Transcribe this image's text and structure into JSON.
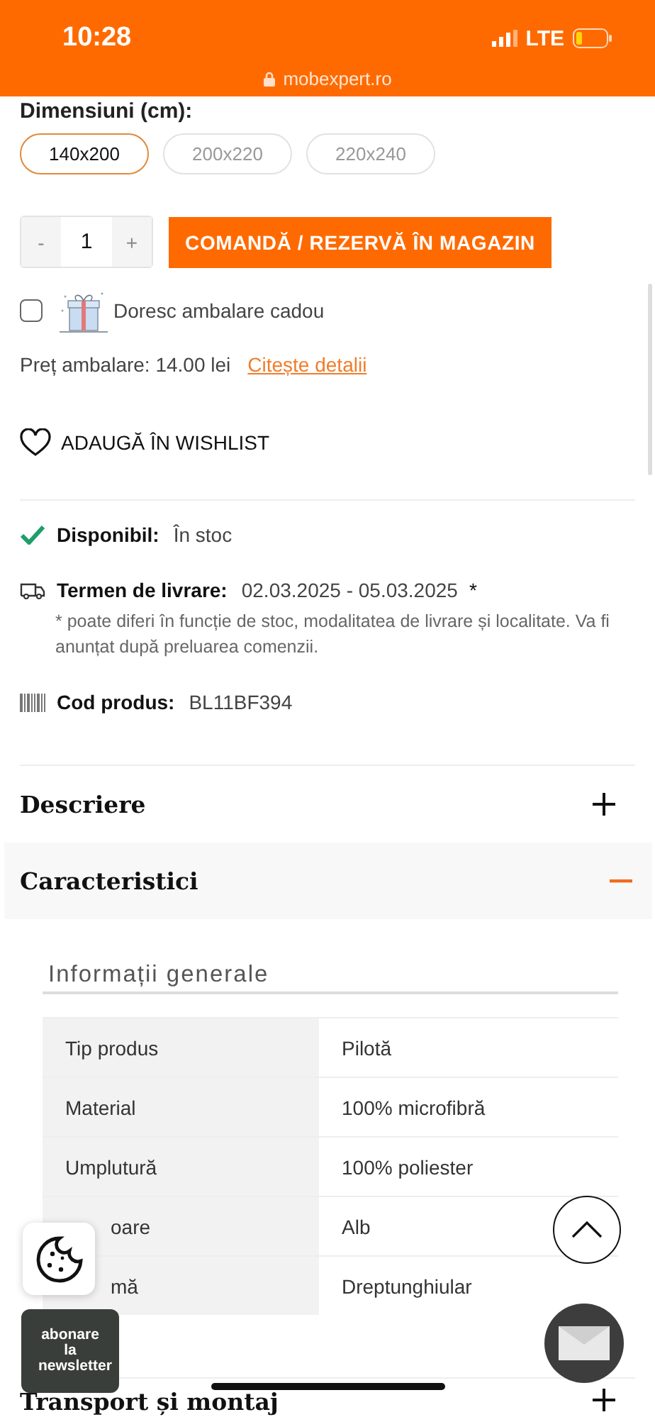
{
  "status_bar": {
    "time": "10:28",
    "network": "LTE",
    "url": "mobexpert.ro"
  },
  "dimensions": {
    "label": "Dimensiuni (cm):",
    "options": [
      {
        "label": "140x200",
        "selected": true
      },
      {
        "label": "200x220",
        "selected": false
      },
      {
        "label": "220x240",
        "selected": false
      }
    ]
  },
  "quantity": {
    "minus": "-",
    "value": "1",
    "plus": "+"
  },
  "order_button": "COMANDĂ / REZERVĂ ÎN MAGAZIN",
  "gift": {
    "label": "Doresc ambalare cadou",
    "checked": false
  },
  "gift_price": {
    "text": "Preț ambalare: 14.00 lei",
    "link": "Citește detalii"
  },
  "wishlist": "ADAUGĂ ÎN WISHLIST",
  "availability": {
    "label": "Disponibil:",
    "value": "În stoc"
  },
  "delivery": {
    "label": "Termen de livrare:",
    "value": "02.03.2025 - 05.03.2025",
    "mark": "*",
    "note": "* poate diferi în funcție de stoc, modalitatea de livrare și localitate. Va fi anunțat după preluarea comenzii."
  },
  "code": {
    "label": "Cod produs:",
    "value": "BL11BF394"
  },
  "sections": [
    {
      "title": "Descriere",
      "expanded": false
    },
    {
      "title": "Caracteristici",
      "expanded": true
    }
  ],
  "specs": {
    "title": "Informații generale",
    "rows": [
      {
        "name": "Tip produs",
        "value": "Pilotă",
        "covered": false
      },
      {
        "name": "Material",
        "value": "100% microfibră",
        "covered": false
      },
      {
        "name": "Umplutură",
        "value": "100% poliester",
        "covered": false
      },
      {
        "name": "oare",
        "value": "Alb",
        "covered": true
      },
      {
        "name": "mă",
        "value": "Dreptunghiular",
        "covered": true
      }
    ]
  },
  "next_section": {
    "title": "Transport și montaj",
    "expanded": false
  },
  "newsletter": "abonare la newsletter"
}
